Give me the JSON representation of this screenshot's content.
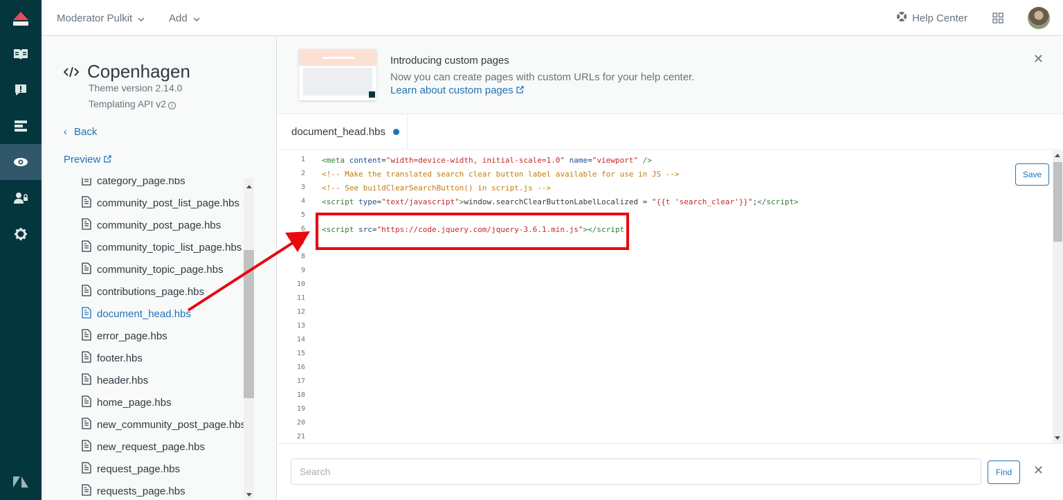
{
  "rail": {
    "items": [
      "zendesk-logo-icon",
      "guide-book-icon",
      "alert-icon",
      "list-icon",
      "eye-icon",
      "user-permissions-icon",
      "gear-icon",
      "zendesk-z-icon"
    ],
    "active": "eye-icon"
  },
  "topbar": {
    "menu1": "Moderator Pulkit",
    "menu2": "Add",
    "help": "Help Center"
  },
  "theme": {
    "name": "Copenhagen",
    "version": "Theme version 2.14.0",
    "api": "Templating API v2",
    "back": "Back",
    "preview": "Preview"
  },
  "files": [
    "category_page.hbs",
    "community_post_list_page.hbs",
    "community_post_page.hbs",
    "community_topic_list_page.hbs",
    "community_topic_page.hbs",
    "contributions_page.hbs",
    "document_head.hbs",
    "error_page.hbs",
    "footer.hbs",
    "header.hbs",
    "home_page.hbs",
    "new_community_post_page.hbs",
    "new_request_page.hbs",
    "request_page.hbs",
    "requests_page.hbs"
  ],
  "active_file": "document_head.hbs",
  "banner": {
    "title": "Introducing custom pages",
    "text": "Now you can create pages with custom URLs for your help center.",
    "link": "Learn about custom pages"
  },
  "tab": {
    "label": "document_head.hbs"
  },
  "editor": {
    "line_numbers": [
      "1",
      "2",
      "3",
      "4",
      "5",
      "6",
      "7",
      "8",
      "9",
      "10",
      "11",
      "12",
      "13",
      "14",
      "15",
      "16",
      "17",
      "18",
      "19",
      "20",
      "21"
    ],
    "save": "Save"
  },
  "search": {
    "placeholder": "Search",
    "find": "Find"
  },
  "colors": {
    "rail": "#03363d",
    "link": "#1f73b7",
    "highlight": "#e8080e"
  }
}
